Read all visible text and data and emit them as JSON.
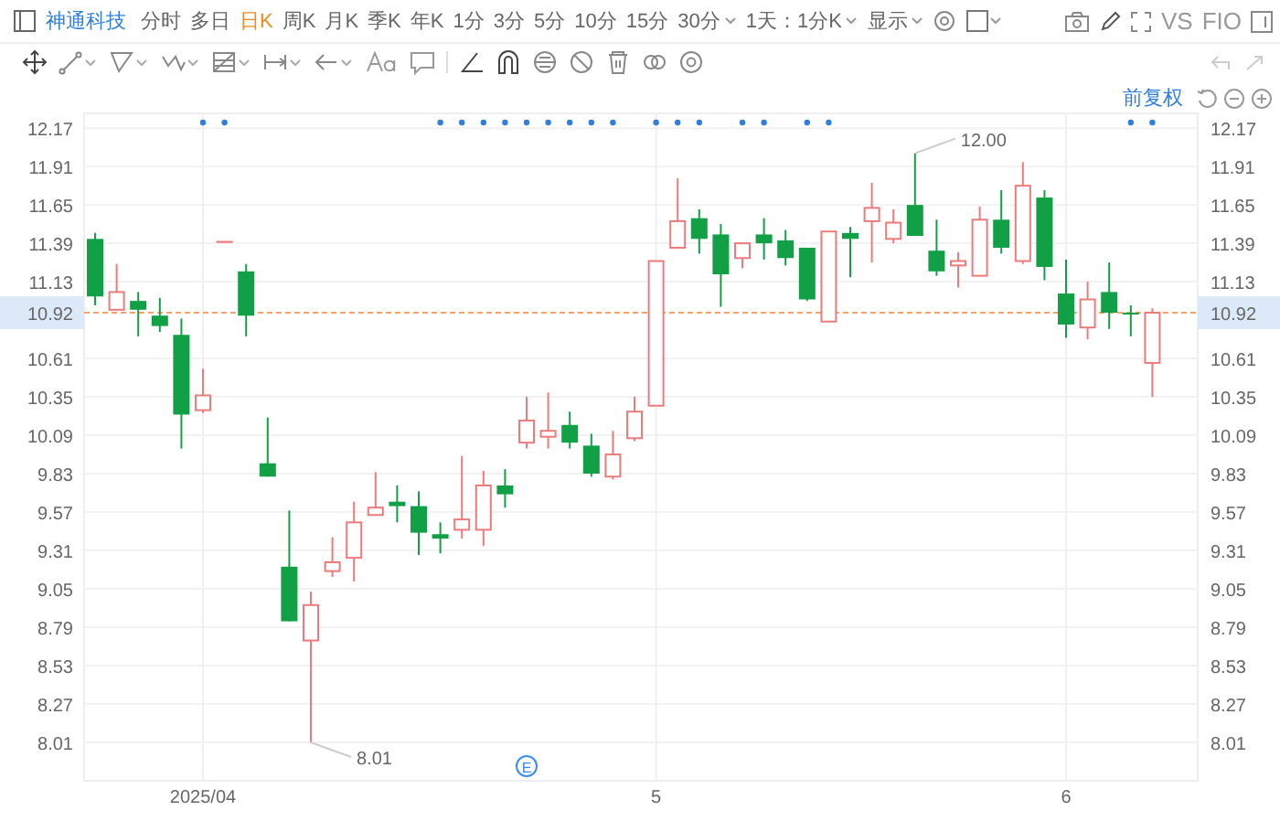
{
  "toolbar": {
    "stock_name": "神通科技",
    "periods": [
      {
        "label": "分时",
        "selected": false,
        "dropdown": false
      },
      {
        "label": "多日",
        "selected": false,
        "dropdown": false
      },
      {
        "label": "日K",
        "selected": true,
        "dropdown": false
      },
      {
        "label": "周K",
        "selected": false,
        "dropdown": false
      },
      {
        "label": "月K",
        "selected": false,
        "dropdown": false
      },
      {
        "label": "季K",
        "selected": false,
        "dropdown": false
      },
      {
        "label": "年K",
        "selected": false,
        "dropdown": false
      },
      {
        "label": "1分",
        "selected": false,
        "dropdown": false
      },
      {
        "label": "3分",
        "selected": false,
        "dropdown": false
      },
      {
        "label": "5分",
        "selected": false,
        "dropdown": false
      },
      {
        "label": "10分",
        "selected": false,
        "dropdown": false
      },
      {
        "label": "15分",
        "selected": false,
        "dropdown": false
      },
      {
        "label": "30分",
        "selected": false,
        "dropdown": true
      },
      {
        "label": "1天：1分K",
        "selected": false,
        "dropdown": true
      },
      {
        "label": "显示",
        "selected": false,
        "dropdown": true
      }
    ],
    "compare_label": "VS",
    "f10_label": "FIO"
  },
  "adjust_label": "前复权",
  "candle_flags": [
    {
      "marked": false
    },
    {
      "marked": false
    },
    {
      "marked": false
    },
    {
      "marked": false
    },
    {
      "marked": false
    },
    {
      "marked": true
    },
    {
      "marked": true
    },
    {
      "marked": false
    },
    {
      "marked": false
    },
    {
      "marked": false
    },
    {
      "marked": false
    },
    {
      "marked": false
    },
    {
      "marked": false
    },
    {
      "marked": false
    },
    {
      "marked": false
    },
    {
      "marked": false
    },
    {
      "marked": true
    },
    {
      "marked": true
    },
    {
      "marked": true
    },
    {
      "marked": true
    },
    {
      "marked": true
    },
    {
      "marked": true
    },
    {
      "marked": true
    },
    {
      "marked": true
    },
    {
      "marked": true
    },
    {
      "marked": false
    },
    {
      "marked": true
    },
    {
      "marked": true
    },
    {
      "marked": true
    },
    {
      "marked": false
    },
    {
      "marked": true
    },
    {
      "marked": true
    },
    {
      "marked": false
    },
    {
      "marked": true
    },
    {
      "marked": true
    },
    {
      "marked": false
    },
    {
      "marked": false
    },
    {
      "marked": false
    },
    {
      "marked": false
    },
    {
      "marked": false
    },
    {
      "marked": false
    },
    {
      "marked": false
    },
    {
      "marked": false
    },
    {
      "marked": false
    },
    {
      "marked": false
    },
    {
      "marked": false
    },
    {
      "marked": false
    },
    {
      "marked": false
    },
    {
      "marked": true
    },
    {
      "marked": true
    }
  ],
  "right_axis_labels": [
    "12.17",
    "11.91",
    "11.65",
    "11.39",
    "11.13",
    "10.61",
    "10.35",
    "10.09",
    "9.83",
    "9.57",
    "9.31",
    "9.05",
    "8.79",
    "8.53",
    "8.27",
    "8.01"
  ],
  "right_price_tag": "10.92",
  "event_marker": {
    "label": "E"
  },
  "chart_data": {
    "type": "candlestick",
    "categories": [
      null,
      null,
      null,
      null,
      null,
      "2025/04",
      null,
      null,
      null,
      null,
      null,
      null,
      null,
      null,
      null,
      null,
      null,
      null,
      null,
      null,
      null,
      null,
      null,
      null,
      null,
      null,
      "5",
      null,
      null,
      null,
      null,
      null,
      null,
      null,
      null,
      null,
      null,
      null,
      null,
      null,
      null,
      null,
      null,
      null,
      null,
      "6",
      null,
      null,
      null,
      null
    ],
    "ylim": [
      7.75,
      12.27
    ],
    "grid": true,
    "yticks": [
      {
        "value": 12.17,
        "label": "12.17"
      },
      {
        "value": 11.91,
        "label": "11.91"
      },
      {
        "value": 11.65,
        "label": "11.65"
      },
      {
        "value": 11.39,
        "label": "11.39"
      },
      {
        "value": 11.13,
        "label": "11.13"
      },
      {
        "value": 10.61,
        "label": "10.61"
      },
      {
        "value": 10.35,
        "label": "10.35"
      },
      {
        "value": 10.09,
        "label": "10.09"
      },
      {
        "value": 9.83,
        "label": "9.83"
      },
      {
        "value": 9.57,
        "label": "9.57"
      },
      {
        "value": 9.31,
        "label": "9.31"
      },
      {
        "value": 9.05,
        "label": "9.05"
      },
      {
        "value": 8.79,
        "label": "8.79"
      },
      {
        "value": 8.53,
        "label": "8.53"
      },
      {
        "value": 8.27,
        "label": "8.27"
      },
      {
        "value": 8.01,
        "label": "8.01"
      }
    ],
    "ref_lines": [
      {
        "axis": "y",
        "value": 10.92,
        "label": "10.92"
      }
    ],
    "annotations": [
      "12.00",
      "8.01"
    ],
    "ohlc": [
      [
        11.42,
        11.46,
        10.97,
        11.03
      ],
      [
        10.94,
        11.25,
        10.94,
        11.06
      ],
      [
        11.0,
        11.06,
        10.76,
        10.94
      ],
      [
        10.9,
        11.02,
        10.79,
        10.83
      ],
      [
        10.77,
        10.88,
        10.0,
        10.23
      ],
      [
        10.26,
        10.54,
        10.24,
        10.36
      ],
      [
        11.4,
        11.4,
        11.4,
        11.4
      ],
      [
        11.2,
        11.25,
        10.76,
        10.9
      ],
      [
        9.9,
        10.21,
        9.81,
        9.81
      ],
      [
        9.2,
        9.58,
        8.83,
        8.83
      ],
      [
        8.7,
        9.03,
        8.01,
        8.94
      ],
      [
        9.17,
        9.4,
        9.13,
        9.23
      ],
      [
        9.26,
        9.64,
        9.1,
        9.5
      ],
      [
        9.55,
        9.84,
        9.55,
        9.6
      ],
      [
        9.64,
        9.75,
        9.5,
        9.61
      ],
      [
        9.61,
        9.71,
        9.28,
        9.43
      ],
      [
        9.42,
        9.5,
        9.29,
        9.39
      ],
      [
        9.45,
        9.95,
        9.39,
        9.52
      ],
      [
        9.45,
        9.85,
        9.34,
        9.75
      ],
      [
        9.75,
        9.86,
        9.6,
        9.69
      ],
      [
        10.04,
        10.35,
        10.0,
        10.19
      ],
      [
        10.08,
        10.38,
        10.0,
        10.12
      ],
      [
        10.16,
        10.25,
        10.0,
        10.04
      ],
      [
        10.02,
        10.1,
        9.81,
        9.83
      ],
      [
        9.81,
        10.12,
        9.79,
        9.96
      ],
      [
        10.07,
        10.35,
        10.05,
        10.25
      ],
      [
        10.29,
        11.27,
        10.29,
        11.27
      ],
      [
        11.36,
        11.83,
        11.36,
        11.54
      ],
      [
        11.56,
        11.62,
        11.32,
        11.42
      ],
      [
        11.45,
        11.52,
        10.96,
        11.18
      ],
      [
        11.29,
        11.39,
        11.22,
        11.39
      ],
      [
        11.45,
        11.56,
        11.28,
        11.39
      ],
      [
        11.41,
        11.48,
        11.24,
        11.29
      ],
      [
        11.36,
        11.36,
        11.0,
        11.01
      ],
      [
        10.86,
        11.47,
        10.86,
        11.47
      ],
      [
        11.46,
        11.5,
        11.16,
        11.42
      ],
      [
        11.54,
        11.8,
        11.26,
        11.63
      ],
      [
        11.42,
        11.62,
        11.39,
        11.53
      ],
      [
        11.65,
        12.0,
        11.44,
        11.44
      ],
      [
        11.34,
        11.55,
        11.17,
        11.2
      ],
      [
        11.24,
        11.33,
        11.09,
        11.27
      ],
      [
        11.17,
        11.64,
        11.17,
        11.55
      ],
      [
        11.55,
        11.75,
        11.32,
        11.36
      ],
      [
        11.27,
        11.94,
        11.25,
        11.78
      ],
      [
        11.7,
        11.75,
        11.14,
        11.23
      ],
      [
        11.05,
        11.28,
        10.75,
        10.84
      ],
      [
        10.82,
        11.13,
        10.74,
        11.01
      ],
      [
        11.06,
        11.26,
        10.81,
        10.92
      ],
      [
        10.92,
        10.97,
        10.76,
        10.91
      ],
      [
        10.58,
        10.95,
        10.35,
        10.92
      ]
    ]
  }
}
